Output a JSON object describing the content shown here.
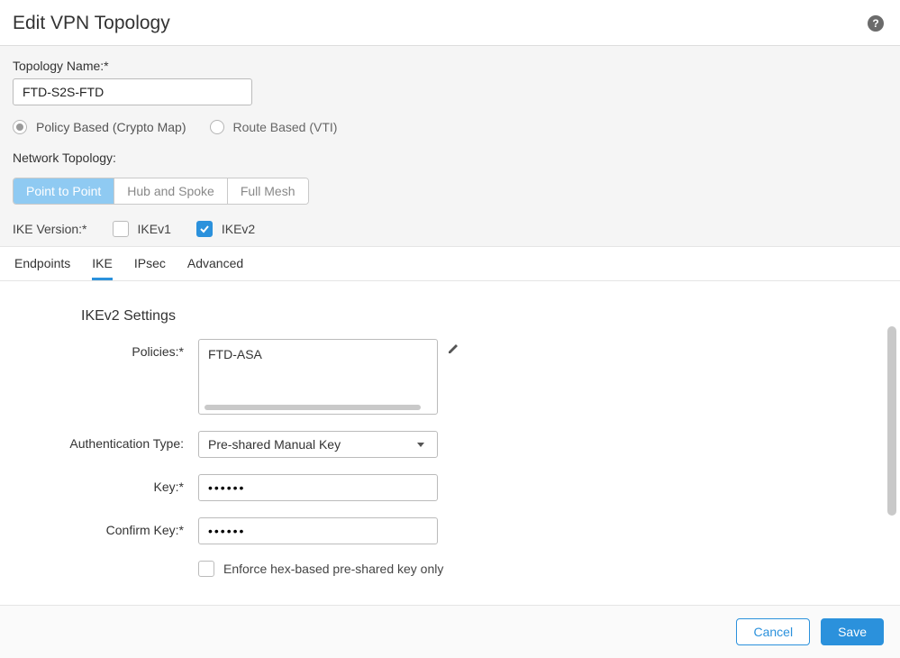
{
  "dialog": {
    "title": "Edit VPN Topology"
  },
  "form": {
    "topology_name_label": "Topology Name:*",
    "topology_name_value": "FTD-S2S-FTD",
    "radio": {
      "policy_based": "Policy Based (Crypto Map)",
      "route_based": "Route Based (VTI)",
      "selected": "policy_based"
    },
    "network_topology_label": "Network Topology:",
    "segments": {
      "p2p": "Point to Point",
      "hub": "Hub and Spoke",
      "full": "Full Mesh",
      "active": "p2p"
    },
    "ike_version_label": "IKE Version:*",
    "ikev1": {
      "label": "IKEv1",
      "checked": false
    },
    "ikev2": {
      "label": "IKEv2",
      "checked": true
    }
  },
  "tabs": {
    "endpoints": "Endpoints",
    "ike": "IKE",
    "ipsec": "IPsec",
    "advanced": "Advanced",
    "active": "ike"
  },
  "ikev2": {
    "heading": "IKEv2 Settings",
    "policies_label": "Policies:*",
    "policies_value": "FTD-ASA",
    "auth_type_label": "Authentication Type:",
    "auth_type_value": "Pre-shared Manual Key",
    "key_label": "Key:*",
    "key_value": "••••••",
    "confirm_key_label": "Confirm Key:*",
    "confirm_key_value": "••••••",
    "enforce_hex_label": "Enforce hex-based pre-shared key only",
    "enforce_hex_checked": false
  },
  "footer": {
    "cancel": "Cancel",
    "save": "Save"
  }
}
